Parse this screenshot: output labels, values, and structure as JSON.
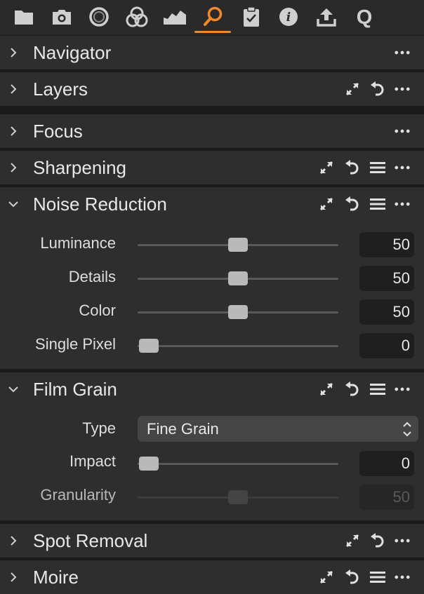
{
  "toolbar": {
    "tabs": [
      {
        "icon": "folder-icon"
      },
      {
        "icon": "camera-icon"
      },
      {
        "icon": "color-circle-icon"
      },
      {
        "icon": "color-channels-icon"
      },
      {
        "icon": "exposure-icon"
      },
      {
        "icon": "details-magnifier-icon",
        "active": true
      },
      {
        "icon": "clipboard-check-icon"
      },
      {
        "icon": "info-icon"
      },
      {
        "icon": "export-icon"
      },
      {
        "icon": "quick-icon"
      }
    ],
    "accent_color": "#ef8a2a"
  },
  "panels": {
    "navigator": {
      "title": "Navigator"
    },
    "layers": {
      "title": "Layers"
    },
    "focus": {
      "title": "Focus"
    },
    "sharpening": {
      "title": "Sharpening"
    },
    "noise_reduction": {
      "title": "Noise Reduction",
      "sliders": [
        {
          "label": "Luminance",
          "value": "50",
          "level": 0.5
        },
        {
          "label": "Details",
          "value": "50",
          "level": 0.5
        },
        {
          "label": "Color",
          "value": "50",
          "level": 0.5
        },
        {
          "label": "Single Pixel",
          "value": "0",
          "level": 0
        }
      ]
    },
    "film_grain": {
      "title": "Film Grain",
      "type_label": "Type",
      "type_value": "Fine Grain",
      "sliders": [
        {
          "label": "Impact",
          "value": "0",
          "level": 0
        },
        {
          "label": "Granularity",
          "value": "50",
          "level": 0.5,
          "disabled": true
        }
      ]
    },
    "spot_removal": {
      "title": "Spot Removal"
    },
    "moire": {
      "title": "Moire"
    }
  }
}
